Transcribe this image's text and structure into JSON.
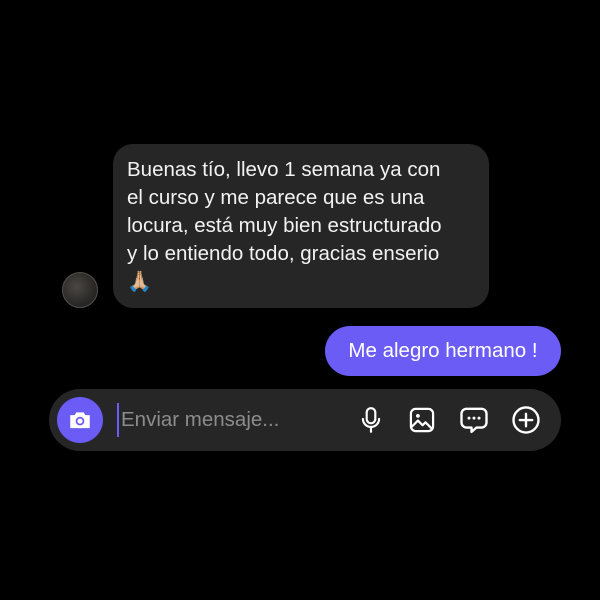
{
  "conversation": {
    "incoming_message": {
      "lines": [
        "Buenas tío, llevo 1 semana ya con",
        "el curso y me parece que es una",
        "locura, está muy bien estructurado",
        "y lo entiendo todo, gracias enserio"
      ],
      "emoji": "🙏🏼"
    },
    "outgoing_message": {
      "text": "Me alegro hermano !"
    }
  },
  "composer": {
    "placeholder": "Enviar mensaje...",
    "value": "",
    "icons": {
      "camera": "camera-icon",
      "mic": "microphone-icon",
      "gallery": "image-icon",
      "sticker": "chat-bubble-icon",
      "plus": "add-circle-icon"
    }
  },
  "colors": {
    "background": "#000000",
    "incoming_bubble": "#262626",
    "outgoing_bubble": "#6a5cf5",
    "accent": "#6a5cf5",
    "text": "#f2f2f2"
  }
}
